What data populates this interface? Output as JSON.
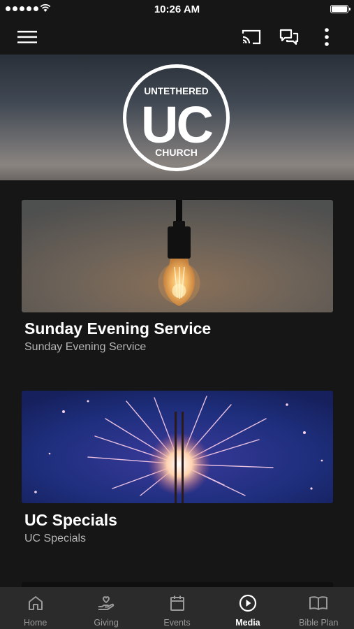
{
  "status_bar": {
    "time": "10:26 AM"
  },
  "header": {
    "menu_icon": "hamburger-menu-icon",
    "cast_icon": "cast-icon",
    "chat_icon": "chat-bubbles-icon",
    "more_icon": "more-vertical-icon"
  },
  "hero": {
    "logo_top": "UNTETHERED",
    "logo_mid": "UC",
    "logo_bottom": "CHURCH"
  },
  "media": [
    {
      "title": "Sunday Evening Service",
      "subtitle": "Sunday Evening Service",
      "image": "light-bulb"
    },
    {
      "title": "UC Specials",
      "subtitle": "UC Specials",
      "image": "sparkler"
    }
  ],
  "tabs": [
    {
      "label": "Home",
      "icon": "home-icon",
      "active": false
    },
    {
      "label": "Giving",
      "icon": "giving-hand-heart-icon",
      "active": false
    },
    {
      "label": "Events",
      "icon": "calendar-icon",
      "active": false
    },
    {
      "label": "Media",
      "icon": "play-circle-icon",
      "active": true
    },
    {
      "label": "Bible Plan",
      "icon": "open-book-icon",
      "active": false
    }
  ],
  "colors": {
    "background": "#161616",
    "tabbar": "#2b2b2b",
    "inactive": "#9a9a9a",
    "active": "#ffffff"
  }
}
